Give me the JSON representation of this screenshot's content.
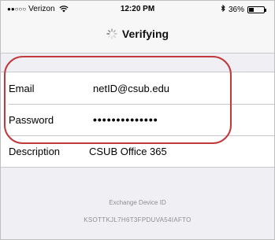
{
  "status_bar": {
    "signal_dots": "●●○○○",
    "carrier": "Verizon",
    "time": "12:20 PM",
    "battery_percent": "36%",
    "battery_level": 0.36,
    "icons": [
      "wifi-icon",
      "bluetooth-icon",
      "battery-icon"
    ]
  },
  "nav": {
    "title": "Verifying",
    "icon": "spinner-icon"
  },
  "form": {
    "rows": [
      {
        "label": "Email",
        "value": "netID@csub.edu"
      },
      {
        "label": "Password",
        "value": "••••••••••••••"
      },
      {
        "label": "Description",
        "value": "CSUB Office 365"
      }
    ]
  },
  "footer": {
    "label": "Exchange Device ID",
    "value": "KSOTTKJL7H6T3FPDUVA54IAFTO"
  },
  "colors": {
    "highlight": "#c0393b",
    "background": "#efeff4",
    "footer_text": "#8e8e93"
  }
}
